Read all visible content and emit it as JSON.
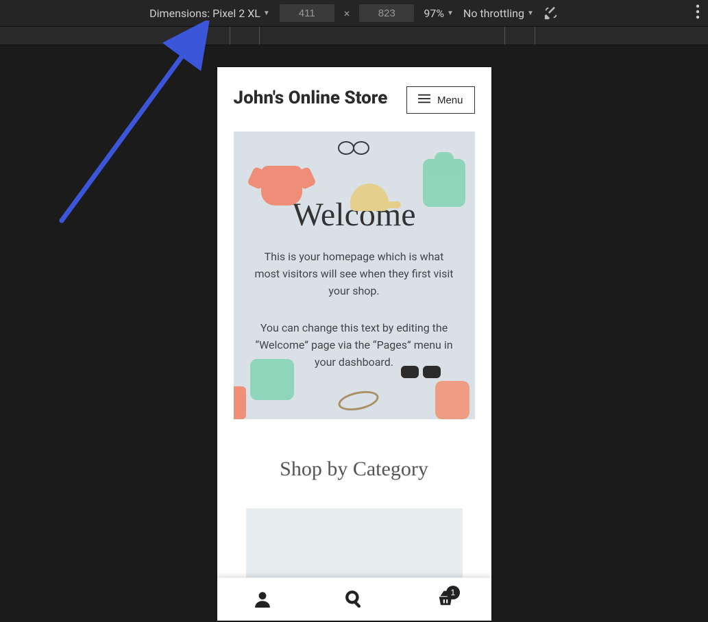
{
  "toolbar": {
    "dimensions_label": "Dimensions:",
    "device_name": "Pixel 2 XL",
    "width_value": "411",
    "height_value": "823",
    "zoom": "97%",
    "throttling": "No throttling"
  },
  "site": {
    "title": "John's Online Store",
    "menu_label": "Menu"
  },
  "hero": {
    "heading": "Welcome",
    "p1": "This is your homepage which is what most visitors will see when they first visit your shop.",
    "p2": "You can change this text by editing the “Welcome” page via the “Pages” menu in your dashboard."
  },
  "category": {
    "heading": "Shop by Category"
  },
  "bottomnav": {
    "cart_count": "1"
  },
  "colors": {
    "arrow": "#3b56d9",
    "hero_bg": "#d9e0e6"
  }
}
